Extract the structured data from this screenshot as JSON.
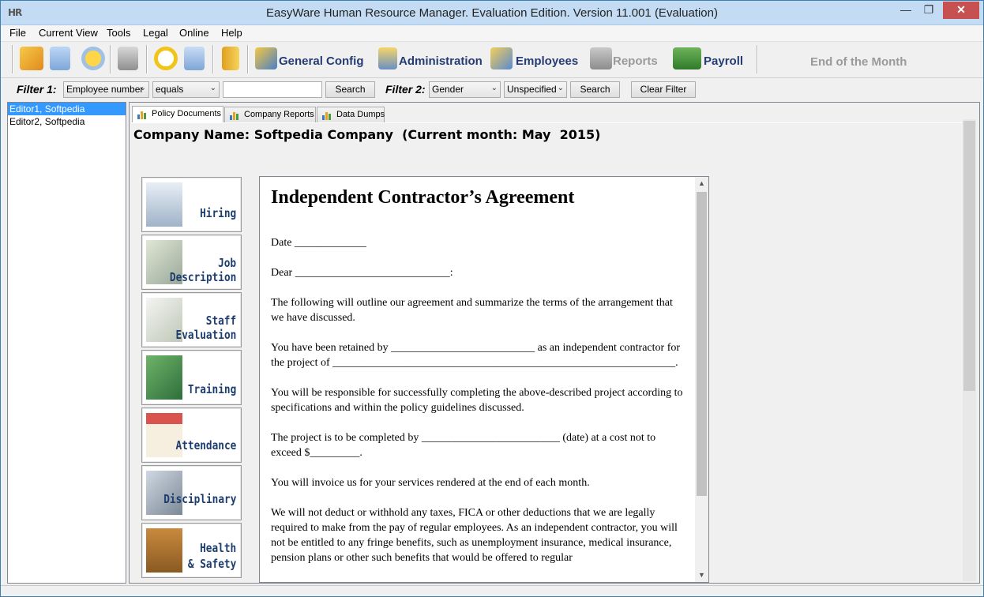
{
  "window": {
    "app_icon": "HR",
    "title": "EasyWare Human Resource Manager. Evaluation Edition. Version 11.001 (Evaluation)",
    "min_glyph": "—",
    "max_glyph": "❐",
    "close_glyph": "✕"
  },
  "menu": [
    "File",
    "Current View",
    "Tools",
    "Legal",
    "Online",
    "Help"
  ],
  "toolbar": {
    "general_config": "General Config",
    "administration": "Administration",
    "employees": "Employees",
    "reports": "Reports",
    "payroll": "Payroll",
    "end_of_month": "End of the Month"
  },
  "filters": {
    "filter1_label": "Filter 1:",
    "filter1_field": "Employee number",
    "filter1_op": "equals",
    "filter1_value": "",
    "search_label": "Search",
    "filter2_label": "Filter 2:",
    "filter2_field": "Gender",
    "filter2_value": "Unspecified",
    "clear_label": "Clear Filter",
    "arrow": "⌄"
  },
  "employees": [
    {
      "name": "Editor1, Softpedia",
      "selected": true
    },
    {
      "name": "Editor2, Softpedia",
      "selected": false
    }
  ],
  "tabs": [
    "Policy Documents",
    "Company Reports",
    "Data Dumps"
  ],
  "company_heading": "Company Name: Softpedia Company  (Current month: May  2015)",
  "categories": [
    {
      "line1": "Hiring",
      "line2": ""
    },
    {
      "line1": "Job",
      "line2": "Description"
    },
    {
      "line1": "Staff",
      "line2": "Evaluation"
    },
    {
      "line1": "Training",
      "line2": ""
    },
    {
      "line1": "Attendance",
      "line2": ""
    },
    {
      "line1": "Disciplinary",
      "line2": ""
    },
    {
      "line1": "Health",
      "line2": "& Safety"
    }
  ],
  "document": {
    "title": "Independent Contractor’s Agreement",
    "paragraphs": [
      "Date _____________",
      "Dear ____________________________:",
      "The following will outline our agreement and summarize the terms of the arrangement that we have discussed.",
      "You have been retained by __________________________ as an independent contractor for the project of ______________________________________________________________.",
      "You will be responsible for successfully completing the above-described project according to specifications and within the policy guidelines discussed.",
      "The project is to be completed by _________________________ (date) at a cost not to exceed $_________.",
      "You will invoice us for your services rendered at the end of each month.",
      "We will not deduct or withhold any taxes, FICA or other deductions that we are legally required to make from the pay of regular employees. As an independent contractor, you will not be entitled to any fringe benefits, such as unemployment insurance, medical insurance, pension plans or other such benefits that would be offered to regular"
    ],
    "scroll_up": "▲",
    "scroll_down": "▼"
  }
}
